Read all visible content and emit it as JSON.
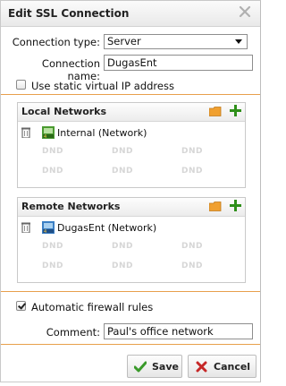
{
  "dialog": {
    "title": "Edit SSL Connection",
    "close_icon": "close-icon"
  },
  "form": {
    "connection_type_label": "Connection type:",
    "connection_type_value": "Server",
    "connection_name_label": "Connection name:",
    "connection_name_value": "DugasEnt",
    "static_ip_label": "Use static virtual IP address",
    "static_ip_checked": false
  },
  "local_networks": {
    "title": "Local Networks",
    "items": [
      {
        "label": "Internal (Network)",
        "icon": "network-icon"
      }
    ],
    "placeholder": "DND"
  },
  "remote_networks": {
    "title": "Remote Networks",
    "items": [
      {
        "label": "DugasEnt (Network)",
        "icon": "network-icon"
      }
    ],
    "placeholder": "DND"
  },
  "firewall": {
    "label": "Automatic firewall rules",
    "checked": true
  },
  "comment": {
    "label": "Comment:",
    "value": "Paul's office network"
  },
  "buttons": {
    "save": "Save",
    "cancel": "Cancel"
  },
  "colors": {
    "accent_orange": "#e8a04c",
    "save_green": "#3a9a2a",
    "cancel_red": "#c62828"
  }
}
